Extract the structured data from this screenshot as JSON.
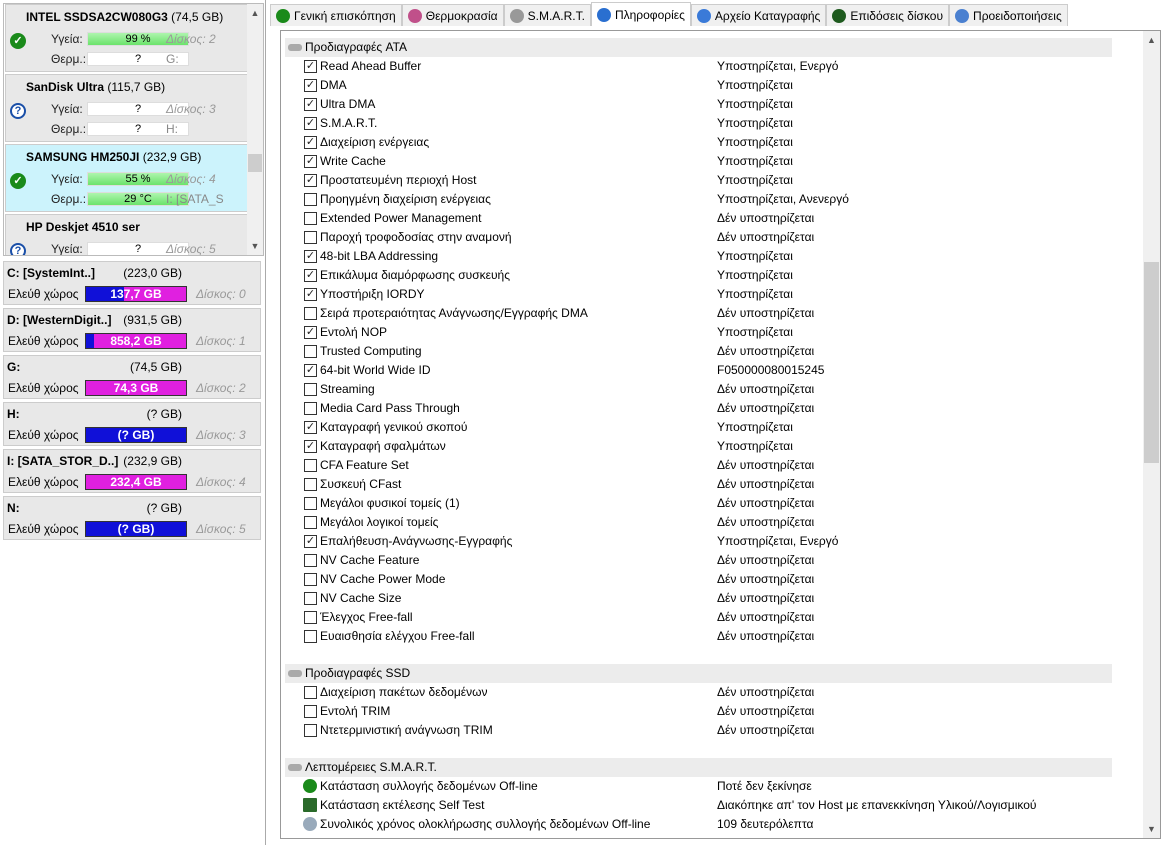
{
  "disks": [
    {
      "model": "INTEL SSDSA2CW080G3",
      "size": "(74,5 GB)",
      "status": "ok",
      "health_label": "Υγεία:",
      "health": "99 %",
      "health_pct": 99,
      "temp_label": "Θερμ.:",
      "temp": "?",
      "disk": "Δίσκος: 2",
      "letter": "G:"
    },
    {
      "model": "SanDisk Ultra",
      "size": "(115,7 GB)",
      "status": "unknown",
      "health_label": "Υγεία:",
      "health": "?",
      "temp_label": "Θερμ.:",
      "temp": "?",
      "disk": "Δίσκος: 3",
      "letter": "H:"
    },
    {
      "model": "SAMSUNG HM250JI",
      "size": "(232,9 GB)",
      "status": "ok",
      "health_label": "Υγεία:",
      "health": "55 %",
      "health_pct": 55,
      "temp_label": "Θερμ.:",
      "temp": "29 °C",
      "disk": "Δίσκος: 4",
      "letter": "I: [SATA_S",
      "selected": true
    },
    {
      "model": "HP     Deskjet 4510 ser",
      "size": "",
      "status": "unknown",
      "health_label": "Υγεία:",
      "health": "?",
      "temp_label": "",
      "temp": "",
      "disk": "Δίσκος: 5",
      "letter": ""
    }
  ],
  "volumes": [
    {
      "name": "C: [SystemInt..]",
      "size": "(223,0 GB)",
      "label": "Ελεύθ χώρος",
      "free": "137,7 GB",
      "used_fraction": 0.38,
      "disk": "Δίσκος: 0"
    },
    {
      "name": "D: [WesternDigit..]",
      "size": "(931,5 GB)",
      "label": "Ελεύθ χώρος",
      "free": "858,2 GB",
      "used_fraction": 0.08,
      "disk": "Δίσκος: 1"
    },
    {
      "name": "G:",
      "size": "(74,5 GB)",
      "label": "Ελεύθ χώρος",
      "free": "74,3 GB",
      "used_fraction": 0.0,
      "disk": "Δίσκος: 2"
    },
    {
      "name": "H:",
      "size": "(? GB)",
      "label": "Ελεύθ χώρος",
      "free": "(? GB)",
      "used_fraction": 1.0,
      "disk": "Δίσκος: 3"
    },
    {
      "name": "I: [SATA_STOR_D..]",
      "size": "(232,9 GB)",
      "label": "Ελεύθ χώρος",
      "free": "232,4 GB",
      "used_fraction": 0.0,
      "disk": "Δίσκος: 4"
    },
    {
      "name": "N:",
      "size": "(? GB)",
      "label": "Ελεύθ χώρος",
      "free": "(? GB)",
      "used_fraction": 1.0,
      "disk": "Δίσκος: 5"
    }
  ],
  "tabs": [
    {
      "label": "Γενική επισκόπηση",
      "icon": "check-circle-icon",
      "color": "#1a8a1a"
    },
    {
      "label": "Θερμοκρασία",
      "icon": "thermometer-icon",
      "color": "#c0508a"
    },
    {
      "label": "S.M.A.R.T.",
      "icon": "drive-icon",
      "color": "#999999"
    },
    {
      "label": "Πληροφορίες",
      "icon": "info-icon",
      "color": "#2a6fd0",
      "active": true
    },
    {
      "label": "Αρχείο Καταγραφής",
      "icon": "document-icon",
      "color": "#3a7ad8"
    },
    {
      "label": "Επιδόσεις δίσκου",
      "icon": "speedometer-icon",
      "color": "#1e5a1e"
    },
    {
      "label": "Προειδοποιήσεις",
      "icon": "pages-icon",
      "color": "#4a80d0"
    }
  ],
  "sections": [
    {
      "title": "Προδιαγραφές ATA",
      "items": [
        [
          "Read Ahead Buffer",
          "Υποστηρίζεται, Ενεργό",
          true
        ],
        [
          "DMA",
          "Υποστηρίζεται",
          true
        ],
        [
          "Ultra DMA",
          "Υποστηρίζεται",
          true
        ],
        [
          "S.M.A.R.T.",
          "Υποστηρίζεται",
          true
        ],
        [
          "Διαχείριση ενέργειας",
          "Υποστηρίζεται",
          true
        ],
        [
          "Write Cache",
          "Υποστηρίζεται",
          true
        ],
        [
          "Προστατευμένη περιοχή Host",
          "Υποστηρίζεται",
          true
        ],
        [
          "Προηγμένη διαχείριση ενέργειας",
          "Υποστηρίζεται, Ανενεργό",
          false
        ],
        [
          "Extended Power Management",
          "Δέν υποστηρίζεται",
          false
        ],
        [
          "Παροχή τροφοδοσίας στην αναμονή",
          "Δέν υποστηρίζεται",
          false
        ],
        [
          "48-bit LBA Addressing",
          "Υποστηρίζεται",
          true
        ],
        [
          "Επικάλυμα διαμόρφωσης συσκευής",
          "Υποστηρίζεται",
          true
        ],
        [
          "Υποστήριξη IORDY",
          "Υποστηρίζεται",
          true
        ],
        [
          "Σειρά προτεραιότητας Ανάγνωσης/Εγγραφής DMA",
          "Δέν υποστηρίζεται",
          false
        ],
        [
          "Εντολή NOP",
          "Υποστηρίζεται",
          true
        ],
        [
          "Trusted Computing",
          "Δέν υποστηρίζεται",
          false
        ],
        [
          "64-bit World Wide ID",
          "F050000080015245",
          true
        ],
        [
          "Streaming",
          "Δέν υποστηρίζεται",
          false
        ],
        [
          "Media Card Pass Through",
          "Δέν υποστηρίζεται",
          false
        ],
        [
          "Καταγραφή γενικού σκοπού",
          "Υποστηρίζεται",
          true
        ],
        [
          "Καταγραφή σφαλμάτων",
          "Υποστηρίζεται",
          true
        ],
        [
          "CFA Feature Set",
          "Δέν υποστηρίζεται",
          false
        ],
        [
          "Συσκευή CFast",
          "Δέν υποστηρίζεται",
          false
        ],
        [
          "Μεγάλοι φυσικοί τομείς (1)",
          "Δέν υποστηρίζεται",
          false
        ],
        [
          "Μεγάλοι λογικοί τομείς",
          "Δέν υποστηρίζεται",
          false
        ],
        [
          "Επαλήθευση-Ανάγνωσης-Εγγραφής",
          "Υποστηρίζεται, Ενεργό",
          true
        ],
        [
          "NV Cache Feature",
          "Δέν υποστηρίζεται",
          false
        ],
        [
          "NV Cache Power Mode",
          "Δέν υποστηρίζεται",
          false
        ],
        [
          "NV Cache Size",
          "Δέν υποστηρίζεται",
          false
        ],
        [
          "Έλεγχος Free-fall",
          "Δέν υποστηρίζεται",
          false
        ],
        [
          "Ευαισθησία ελέγχου Free-fall",
          "Δέν υποστηρίζεται",
          false
        ]
      ]
    },
    {
      "title": "Προδιαγραφές SSD",
      "items": [
        [
          "Διαχείριση πακέτων δεδομένων",
          "Δέν υποστηρίζεται",
          false
        ],
        [
          "Εντολή TRIM",
          "Δέν υποστηρίζεται",
          false
        ],
        [
          "Ντετερμινιστική ανάγνωση TRIM",
          "Δέν υποστηρίζεται",
          false
        ]
      ]
    },
    {
      "title": "Λεπτομέρειες S.M.A.R.T.",
      "icons": true,
      "items": [
        [
          "Κατάσταση συλλογής δεδομένων Off-line",
          "Ποτέ δεν ξεκίνησε",
          "check-circle-icon"
        ],
        [
          "Κατάσταση εκτέλεσης Self Test",
          "Διακόπηκε απ' τον Host με επανεκκίνηση Υλικού/Λογισμικού",
          "chip-icon"
        ],
        [
          "Συνολικός χρόνος ολοκλήρωσης συλλογής δεδομένων Off-line",
          "109 δευτερόλεπτα",
          "clock-icon"
        ]
      ]
    }
  ]
}
